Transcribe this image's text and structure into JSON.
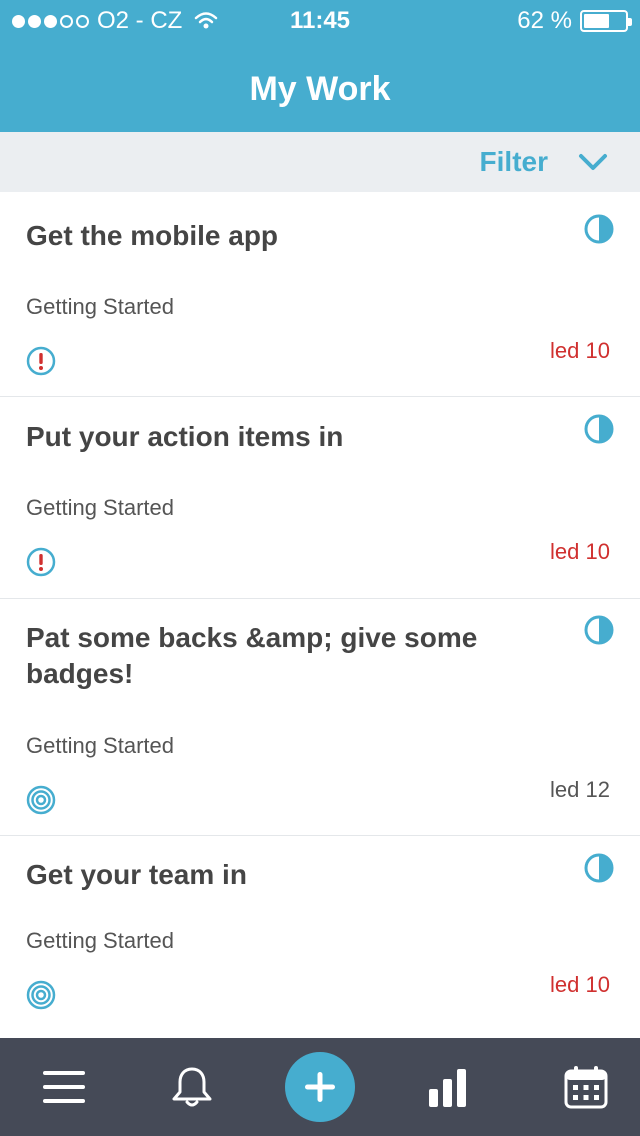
{
  "status_bar": {
    "carrier": "O2 - CZ",
    "time": "11:45",
    "battery_text": "62 %",
    "battery_level": 0.62,
    "signal_bars_filled": 3,
    "signal_bars_total": 5
  },
  "nav": {
    "title": "My Work"
  },
  "filter": {
    "label": "Filter"
  },
  "tasks": [
    {
      "title": "Get the mobile app",
      "category": "Getting Started",
      "due": "led 10",
      "priority": "exclamation",
      "overdue": true
    },
    {
      "title": "Put your action items in",
      "category": "Getting Started",
      "due": "led 10",
      "priority": "exclamation",
      "overdue": true
    },
    {
      "title": "Pat some backs &amp; give some badges!",
      "category": "Getting Started",
      "due": "led 12",
      "priority": "target",
      "overdue": false
    },
    {
      "title": "Get your team in",
      "category": "Getting Started",
      "due": "led 10",
      "priority": "target",
      "overdue": true
    }
  ],
  "tabbar": {
    "items": [
      "menu-icon",
      "bell-icon",
      "add-icon",
      "bar-chart-icon",
      "calendar-icon"
    ]
  },
  "colors": {
    "accent": "#46adcf",
    "overdue": "#d0302f",
    "tabbar_bg": "#454a57",
    "filterbar_bg": "#ebeef1"
  }
}
